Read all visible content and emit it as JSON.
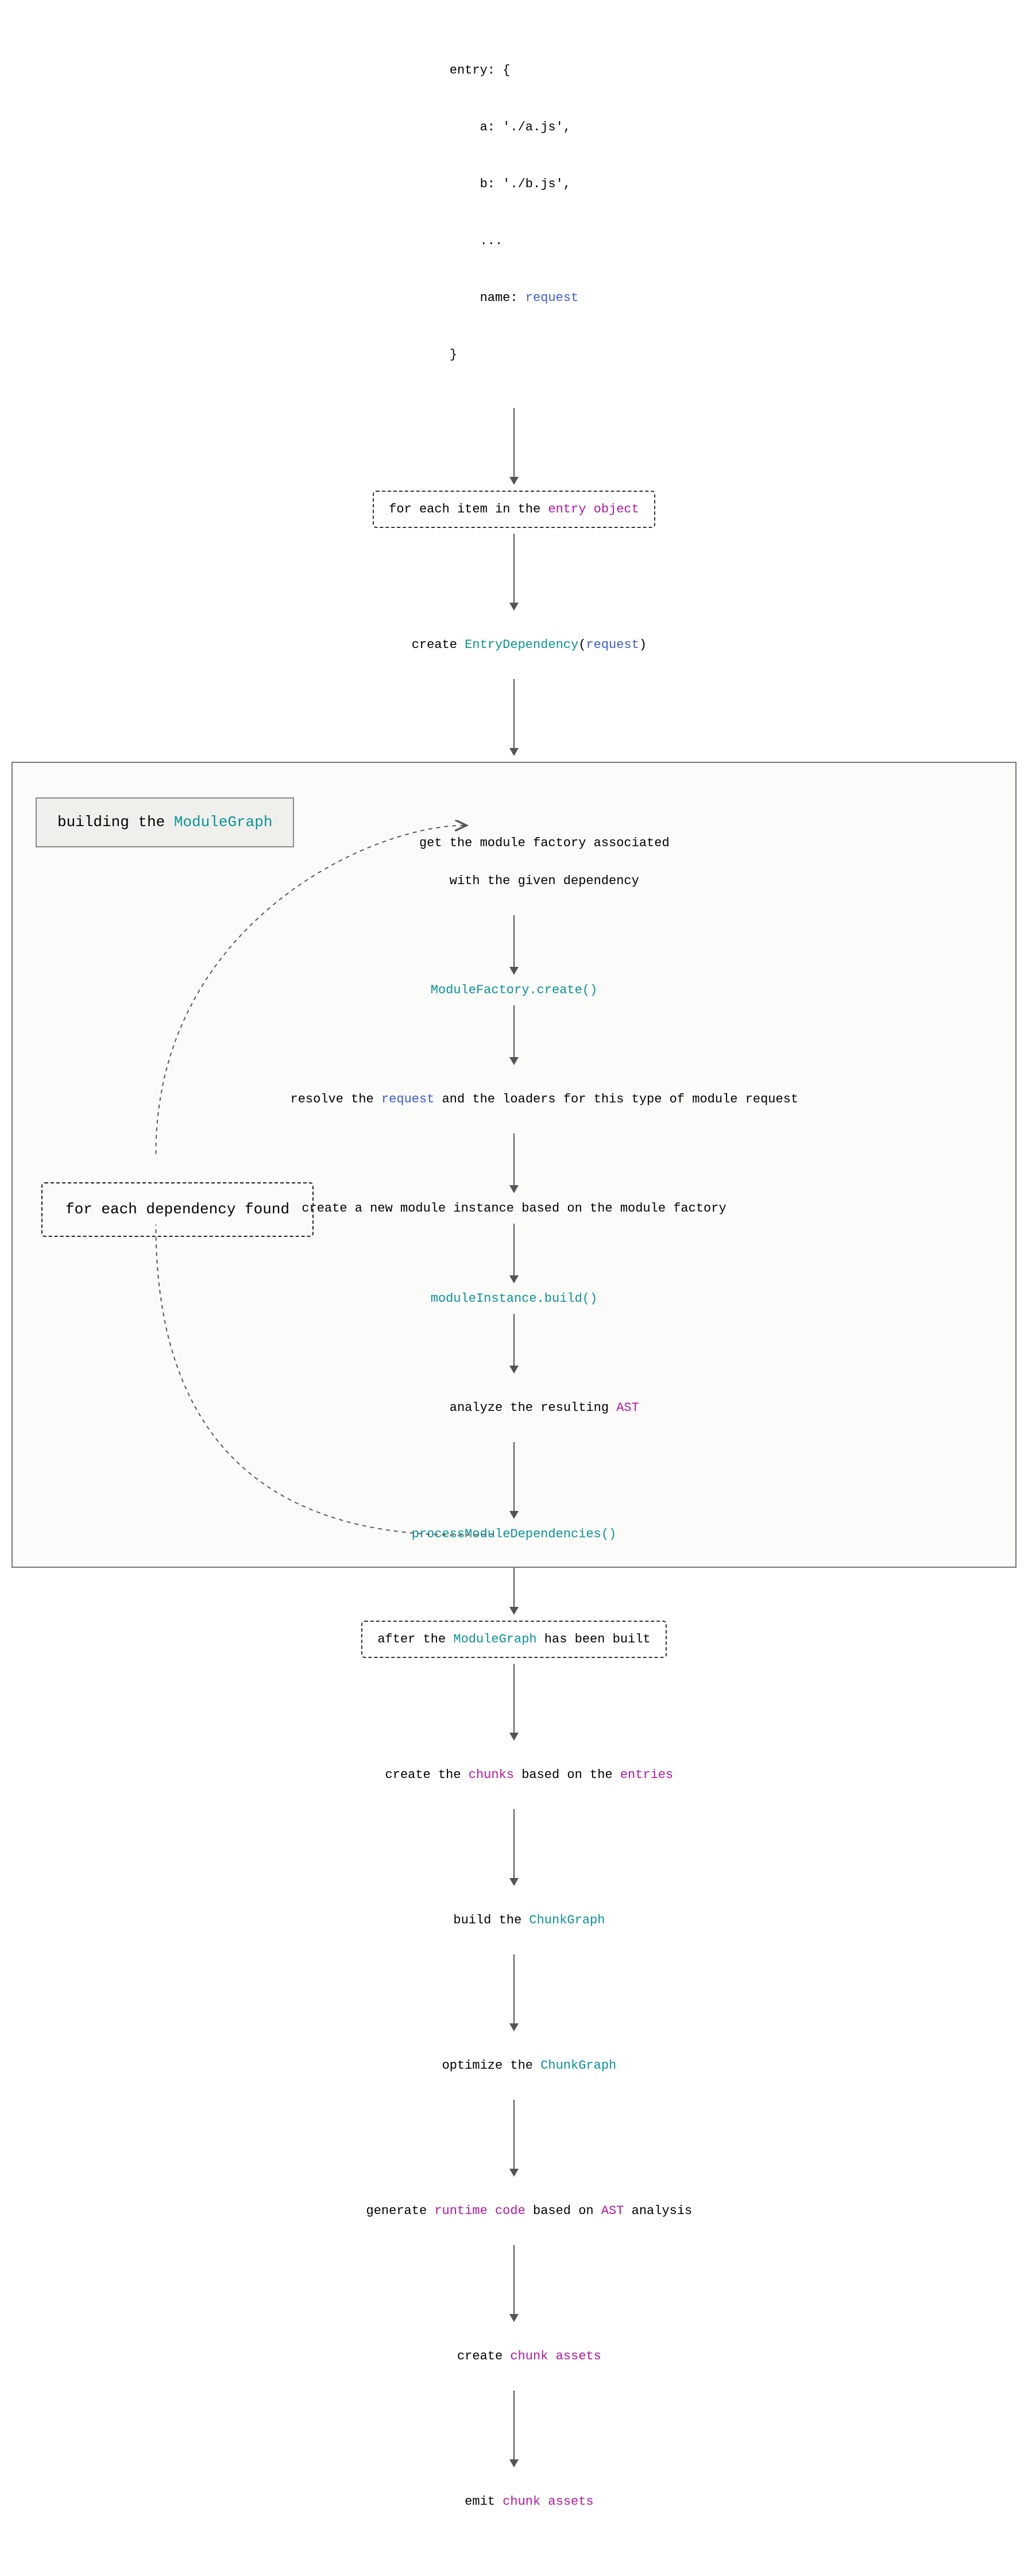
{
  "entry_block": {
    "l1": "entry: {",
    "l2": "a: './a.js',",
    "l3": "b: './b.js',",
    "l4": "...",
    "l5a": "name: ",
    "l5b": "request",
    "l6": "}"
  },
  "steps": {
    "for_each_entry_pre": "for each item in the ",
    "for_each_entry_hl": "entry object",
    "create_dep_pre": "create ",
    "create_dep_cls": "EntryDependency",
    "create_dep_open": "(",
    "create_dep_arg": "request",
    "create_dep_close": ")"
  },
  "module_graph": {
    "title_pre": "building the ",
    "title_hl": "ModuleGraph",
    "n1_l1": "get the module factory associated",
    "n1_l2": "with the given dependency",
    "n2": "ModuleFactory.create()",
    "n3_pre": "resolve the ",
    "n3_hl": "request",
    "n3_post": " and the loaders for this type of module request",
    "n4": "create a new module instance based on the module factory",
    "side_label": "for each dependency found",
    "n5": "moduleInstance.build()",
    "n6_pre": "analyze the resulting ",
    "n6_hl": "AST",
    "n7": "processModuleDependencies()"
  },
  "tail": {
    "after_built_pre": "after the ",
    "after_built_hl": "ModuleGraph",
    "after_built_post": " has been built",
    "chunks_pre": "create the ",
    "chunks_hl": "chunks",
    "chunks_mid": " based on the ",
    "chunks_hl2": "entries",
    "build_cg_pre": "build the ",
    "build_cg_hl": "ChunkGraph",
    "opt_cg_pre": "optimize the ",
    "opt_cg_hl": "ChunkGraph",
    "gen_rc_pre": "generate ",
    "gen_rc_hl": "runtime code",
    "gen_rc_mid": " based on ",
    "gen_rc_hl2": "AST",
    "gen_rc_post": " analysis",
    "create_ca_pre": "create ",
    "create_ca_hl": "chunk assets",
    "emit_ca_pre": "emit ",
    "emit_ca_hl": "chunk assets"
  }
}
